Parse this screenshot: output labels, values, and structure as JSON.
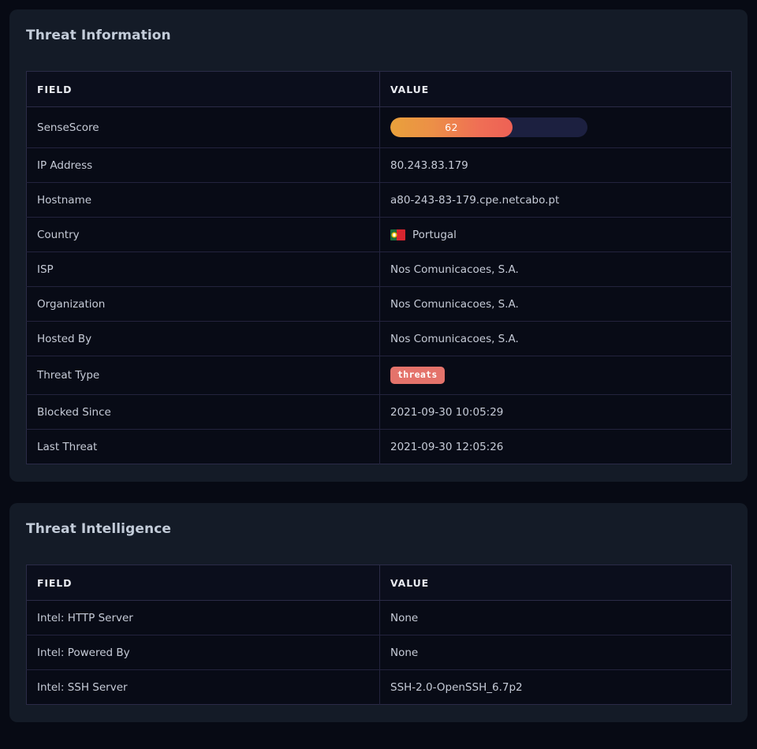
{
  "panels": [
    {
      "title": "Threat Information",
      "columns": {
        "field": "FIELD",
        "value": "VALUE"
      },
      "rows": [
        {
          "field": "SenseScore",
          "kind": "score",
          "value": "62"
        },
        {
          "field": "IP Address",
          "kind": "text",
          "value": "80.243.83.179"
        },
        {
          "field": "Hostname",
          "kind": "text",
          "value": "a80-243-83-179.cpe.netcabo.pt"
        },
        {
          "field": "Country",
          "kind": "flag",
          "value": "Portugal",
          "flag": "portugal-flag-icon"
        },
        {
          "field": "ISP",
          "kind": "text",
          "value": "Nos Comunicacoes, S.A."
        },
        {
          "field": "Organization",
          "kind": "text",
          "value": "Nos Comunicacoes, S.A."
        },
        {
          "field": "Hosted By",
          "kind": "danger",
          "value": "Nos Comunicacoes, S.A."
        },
        {
          "field": "Threat Type",
          "kind": "badge",
          "value": "threats"
        },
        {
          "field": "Blocked Since",
          "kind": "text",
          "value": "2021-09-30 10:05:29"
        },
        {
          "field": "Last Threat",
          "kind": "text",
          "value": "2021-09-30 12:05:26"
        }
      ]
    },
    {
      "title": "Threat Intelligence",
      "columns": {
        "field": "FIELD",
        "value": "VALUE"
      },
      "rows": [
        {
          "field": "Intel: HTTP Server",
          "kind": "text",
          "value": "None"
        },
        {
          "field": "Intel: Powered By",
          "kind": "text",
          "value": "None"
        },
        {
          "field": "Intel: SSH Server",
          "kind": "text",
          "value": "SSH-2.0-OpenSSH_6.7p2"
        }
      ]
    }
  ],
  "score": {
    "value": 62,
    "max": 100,
    "percent": 62,
    "track_color": "#1c2040",
    "gradient_from": "#e9a13b",
    "gradient_to": "#ee6155"
  },
  "colors": {
    "page_background": "#070a14",
    "panel_background": "#141b27",
    "cell_background": "#080b16",
    "header_background": "#0b0e1c",
    "border": "#2b2b47",
    "title_text": "#c3ccd9",
    "header_text": "#e9ebf1",
    "body_text": "#c6cbd7",
    "danger_text": "#e4584f",
    "badge_background": "#e4736b",
    "badge_text": "#ffffff"
  }
}
